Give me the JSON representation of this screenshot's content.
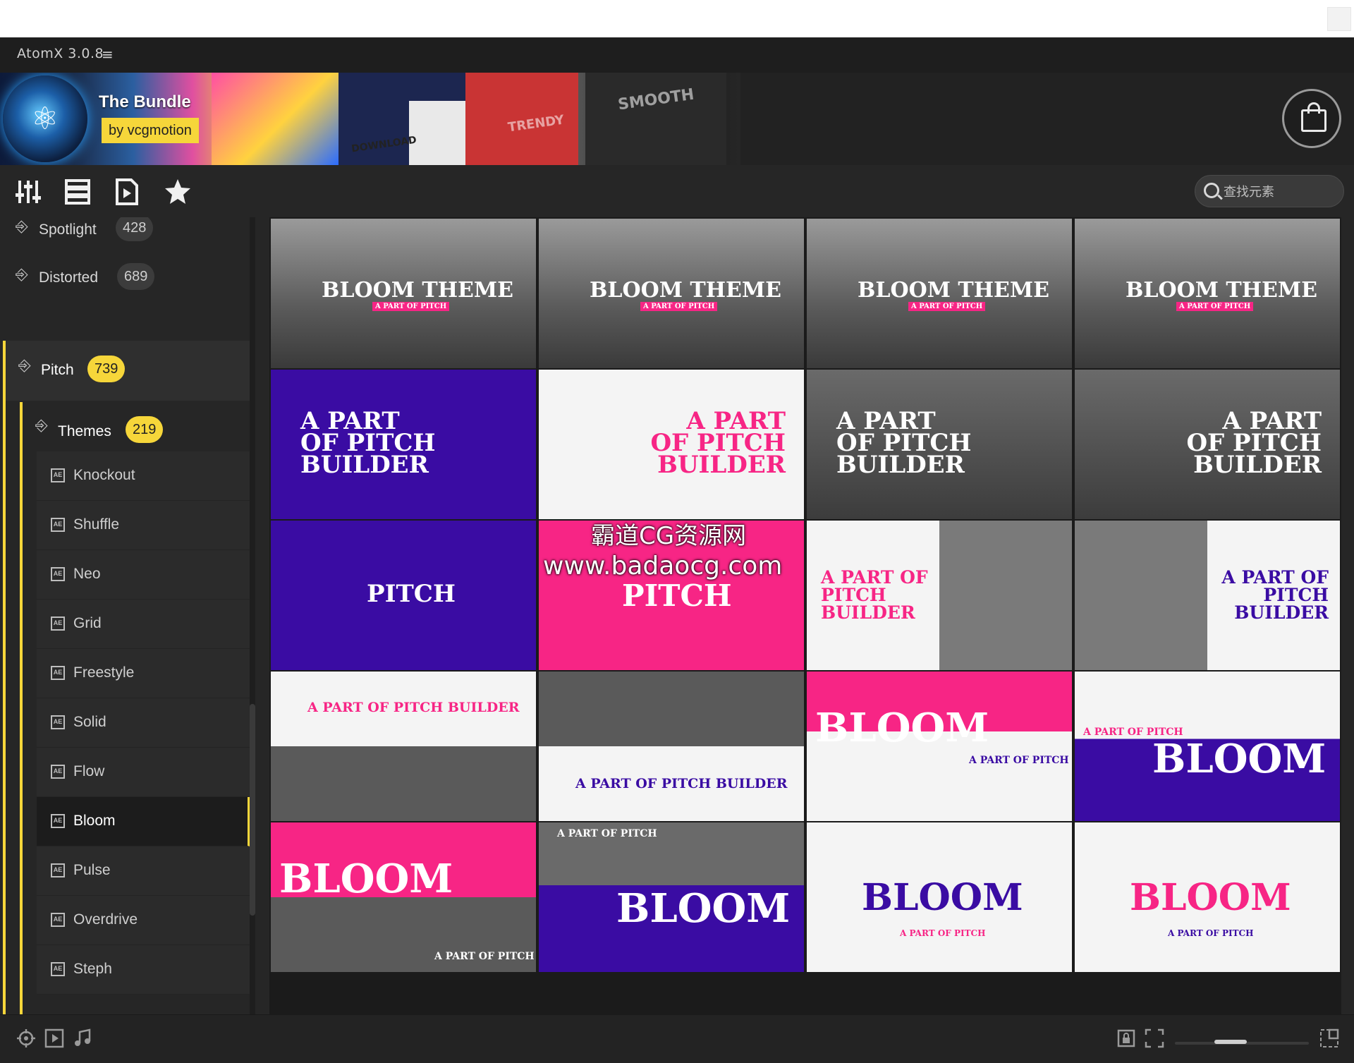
{
  "window": {
    "title": "AtomX 3.0.8"
  },
  "banner": {
    "bundle_title": "The Bundle",
    "author": "by vcgmotion",
    "art_words": [
      "SMOOTH",
      "TRENDY",
      "DOWNLOAD"
    ]
  },
  "search": {
    "placeholder": "查找元素"
  },
  "sidebar": {
    "categories": [
      {
        "label": "Spotlight",
        "count": "428"
      },
      {
        "label": "Distorted",
        "count": "689"
      },
      {
        "label": "Pitch",
        "count": "739",
        "active": true
      }
    ],
    "subcategory": {
      "label": "Themes",
      "count": "219"
    },
    "themes": [
      {
        "label": "Knockout"
      },
      {
        "label": "Shuffle"
      },
      {
        "label": "Neo"
      },
      {
        "label": "Grid"
      },
      {
        "label": "Freestyle"
      },
      {
        "label": "Solid"
      },
      {
        "label": "Flow"
      },
      {
        "label": "Bloom",
        "selected": true
      },
      {
        "label": "Pulse"
      },
      {
        "label": "Overdrive"
      },
      {
        "label": "Steph"
      }
    ]
  },
  "thumbnails": [
    {
      "main": "BLOOM THEME",
      "sub": "A PART OF PITCH"
    },
    {
      "main": "BLOOM THEME",
      "sub": "A PART OF PITCH"
    },
    {
      "main": "BLOOM THEME",
      "sub": "A PART OF PITCH"
    },
    {
      "main": "BLOOM THEME",
      "sub": "A PART OF PITCH"
    },
    {
      "main": "A PART OF PITCH BUILDER"
    },
    {
      "main": "A PART OF PITCH BUILDER"
    },
    {
      "main": "A PART OF PITCH BUILDER"
    },
    {
      "main": "A PART OF PITCH BUILDER"
    },
    {
      "main": "PITCH"
    },
    {
      "main": "PITCH"
    },
    {
      "main": "A PART OF PITCH BUILDER"
    },
    {
      "main": "A PART OF PITCH BUILDER"
    },
    {
      "main": "A PART OF PITCH BUILDER"
    },
    {
      "main": "A PART OF PITCH BUILDER"
    },
    {
      "main": "BLOOM",
      "sub": "A PART OF PITCH"
    },
    {
      "main": "BLOOM",
      "sub": "A PART OF PITCH"
    },
    {
      "main": "BLOOM",
      "sub": "A PART OF PITCH"
    },
    {
      "main": "BLOOM",
      "sub": "A PART OF PITCH"
    },
    {
      "main": "BLOOM",
      "sub": "A PART OF PITCH"
    },
    {
      "main": "BLOOM",
      "sub": "A PART OF PITCH"
    }
  ],
  "watermark": {
    "line1": "霸道CG资源网",
    "line2": "www.badaocg.com"
  },
  "colors": {
    "accent": "#f6d63a",
    "purple": "#3a0ca3",
    "pink": "#f72585"
  },
  "icons": {
    "toolbar": [
      "sliders-icon",
      "list-icon",
      "play-document-icon",
      "star-icon"
    ],
    "status": [
      "target-icon",
      "play-box-icon",
      "music-note-icon",
      "lock-icon",
      "expand-icon",
      "fullscreen-icon"
    ]
  }
}
